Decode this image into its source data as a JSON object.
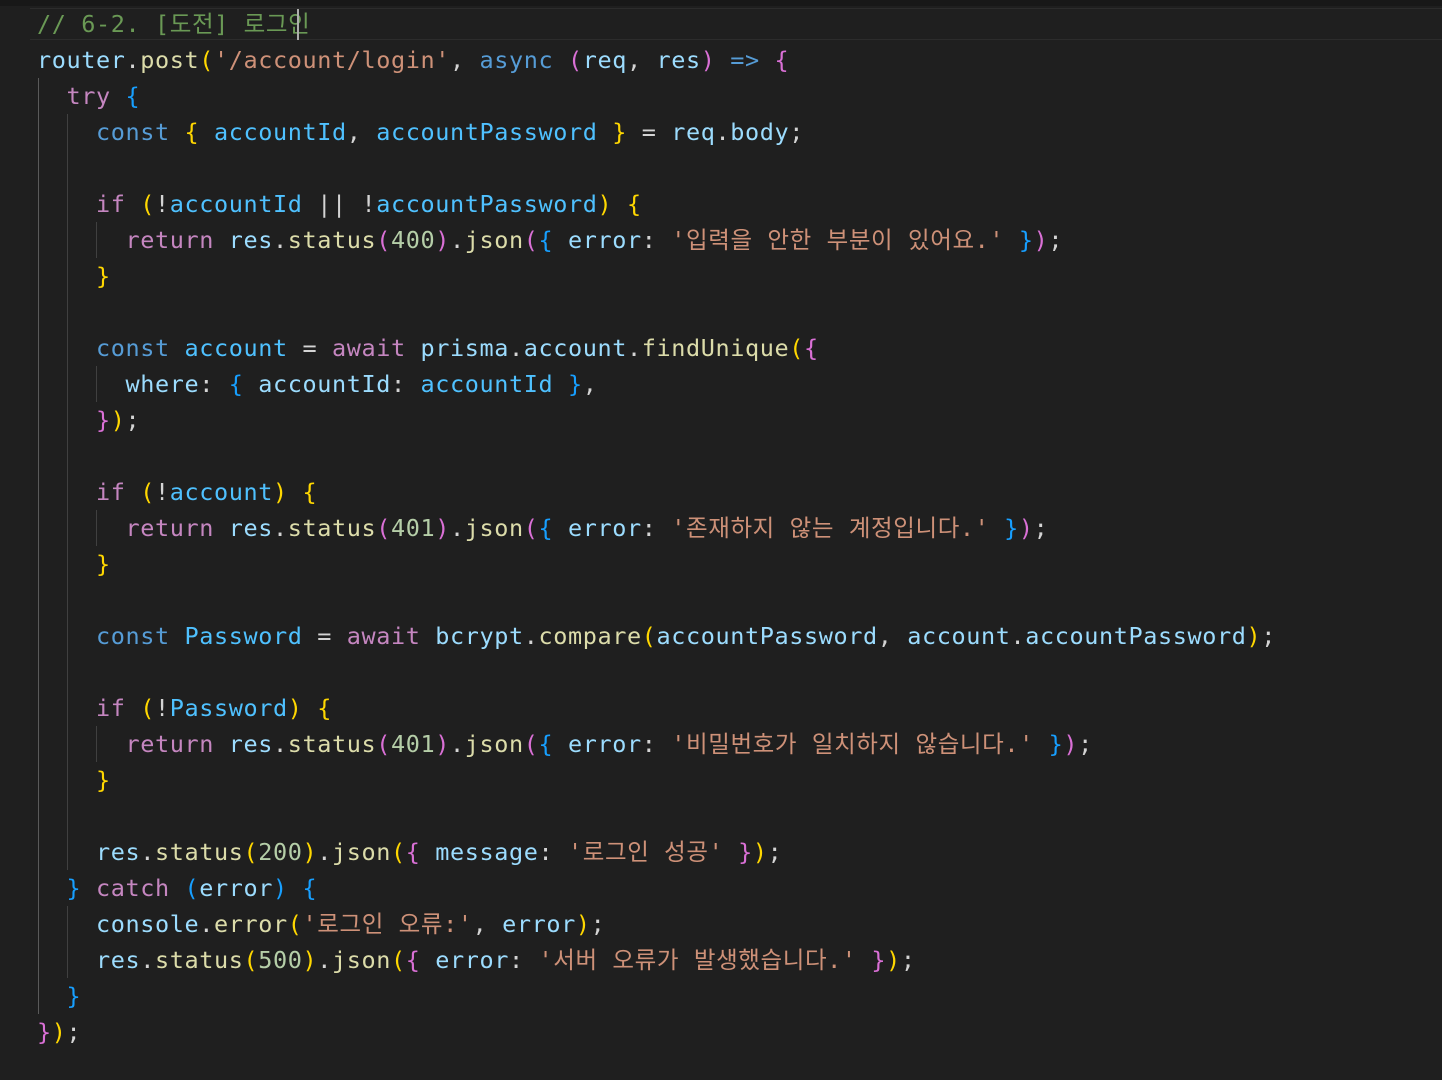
{
  "editor": {
    "language": "javascript",
    "code_lines": [
      "// 6-2. [도전] 로그인",
      "router.post('/account/login', async (req, res) => {",
      "  try {",
      "    const { accountId, accountPassword } = req.body;",
      "",
      "    if (!accountId || !accountPassword) {",
      "      return res.status(400).json({ error: '입력을 안한 부분이 있어요.' });",
      "    }",
      "",
      "    const account = await prisma.account.findUnique({",
      "      where: { accountId: accountId },",
      "    });",
      "",
      "    if (!account) {",
      "      return res.status(401).json({ error: '존재하지 않는 계정입니다.' });",
      "    }",
      "",
      "    const Password = await bcrypt.compare(accountPassword, account.accountPassword);",
      "",
      "    if (!Password) {",
      "      return res.status(401).json({ error: '비밀번호가 일치하지 않습니다.' });",
      "    }",
      "",
      "    res.status(200).json({ message: '로그인 성공' });",
      "  } catch (error) {",
      "    console.error('로그인 오류:', error);",
      "    res.status(500).json({ error: '서버 오류가 발생했습니다.' });",
      "  }",
      "});"
    ]
  },
  "colors": {
    "background": "#1f1f1f",
    "comment": "#6a9955",
    "keyword": "#569cd6",
    "control": "#c586c0",
    "function": "#dcdcaa",
    "variable": "#9cdcfe",
    "string": "#ce9178",
    "number": "#b5cea8",
    "bracket_level_1": "#ffd700",
    "bracket_level_2": "#da70d6",
    "bracket_level_3": "#179fff"
  }
}
